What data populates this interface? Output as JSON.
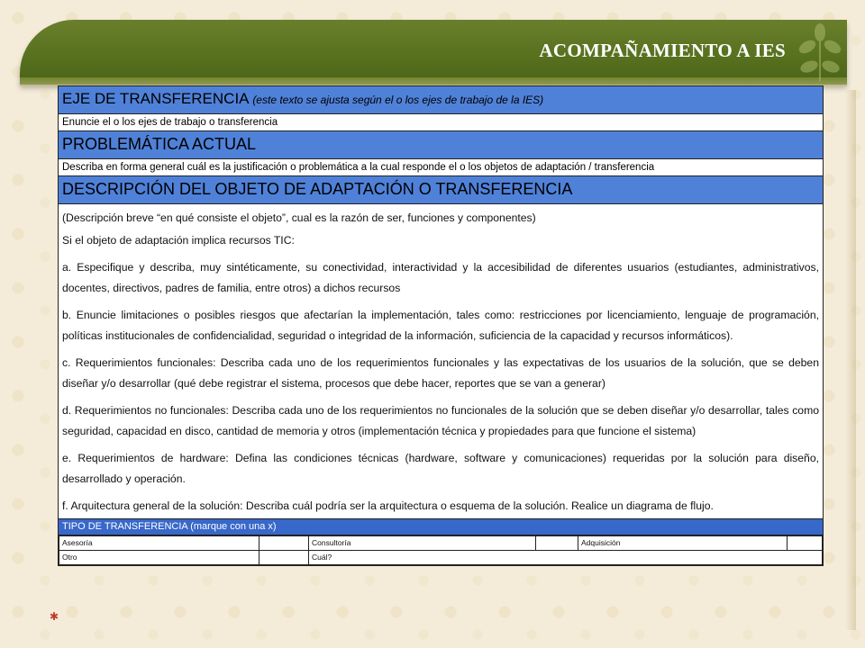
{
  "banner": {
    "title": "ACOMPAÑAMIENTO A IES"
  },
  "sections": {
    "eje": {
      "title": "EJE DE TRANSFERENCIA",
      "subtitle": "(este texto se ajusta según el o los ejes de trabajo de la IES)",
      "instruction": "Enuncie el o los ejes de trabajo o transferencia"
    },
    "problematica": {
      "title": "PROBLEMÁTICA ACTUAL",
      "instruction": "Describa en forma general cuál es la justificación o problemática a la cual responde el o los objetos de adaptación / transferencia"
    },
    "descripcion": {
      "title": "DESCRIPCIÓN DEL OBJETO DE ADAPTACIÓN O TRANSFERENCIA",
      "p0": "(Descripción breve “en qué consiste el objeto”, cual es la razón de ser, funciones y componentes)",
      "p1": "Si el objeto de adaptación implica recursos TIC:",
      "a": "a. Especifique y describa, muy sintéticamente, su conectividad, interactividad y la accesibilidad de diferentes usuarios (estudiantes, administrativos, docentes, directivos, padres de familia, entre otros) a dichos recursos",
      "b": "b. Enuncie limitaciones o posibles riesgos que afectarían la implementación, tales como: restricciones por licenciamiento, lenguaje de programación, políticas institucionales de confidencialidad, seguridad o integridad de la información, suficiencia de la capacidad y recursos informáticos).",
      "c": "c. Requerimientos funcionales: Describa cada uno de los requerimientos funcionales y las expectativas de los usuarios de la solución, que se deben diseñar y/o desarrollar (qué debe registrar el sistema, procesos que debe hacer, reportes que se van a generar)",
      "d": "d. Requerimientos no funcionales: Describa cada uno de los requerimientos no funcionales de la solución que se deben diseñar y/o desarrollar, tales como seguridad, capacidad en disco, cantidad de memoria y otros (implementación técnica y propiedades para que funcione el sistema)",
      "e": "e. Requerimientos de hardware: Defina las condiciones técnicas (hardware, software y comunicaciones) requeridas por la solución para diseño, desarrollado y operación.",
      "f": "f. Arquitectura general de la solución: Describa cuál podría ser la arquitectura o esquema de la solución. Realice un diagrama de flujo."
    },
    "tipo": {
      "title": "TIPO DE TRANSFERENCIA",
      "hint": "(marque con una x)",
      "row1": [
        "Asesoría",
        "",
        "Consultoría",
        "",
        "Adquisición",
        ""
      ],
      "row2": [
        "Otro",
        "",
        "Cuál?",
        "",
        "",
        ""
      ]
    }
  },
  "colors": {
    "header_blue": "#4f81d8",
    "banner_green": "#56701e"
  }
}
